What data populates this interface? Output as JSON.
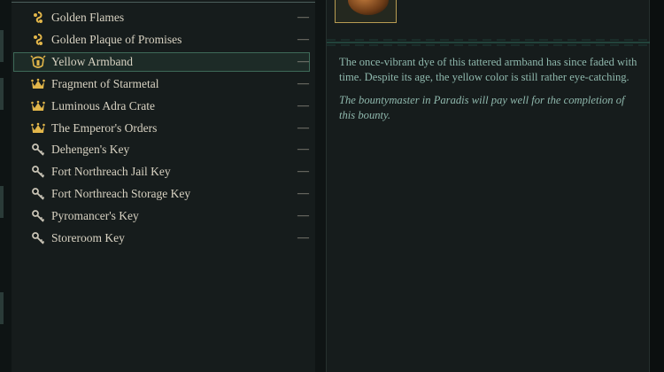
{
  "items": [
    {
      "label": "Golden Flames",
      "icon": "swirl-icon",
      "status": "—"
    },
    {
      "label": "Golden Plaque of Promises",
      "icon": "swirl-icon",
      "status": "—"
    },
    {
      "label": "Yellow Armband",
      "icon": "helmet-icon",
      "status": "—",
      "selected": true
    },
    {
      "label": "Fragment of Starmetal",
      "icon": "crown-icon",
      "status": "—"
    },
    {
      "label": "Luminous Adra Crate",
      "icon": "crown-icon",
      "status": "—"
    },
    {
      "label": "The Emperor's Orders",
      "icon": "crown-icon",
      "status": "—"
    },
    {
      "label": "Dehengen's Key",
      "icon": "key-icon",
      "status": "—"
    },
    {
      "label": "Fort Northreach Jail Key",
      "icon": "key-icon",
      "status": "—"
    },
    {
      "label": "Fort Northreach Storage Key",
      "icon": "key-icon",
      "status": "—"
    },
    {
      "label": "Pyromancer's Key",
      "icon": "key-icon",
      "status": "—"
    },
    {
      "label": "Storeroom Key",
      "icon": "key-icon",
      "status": "—"
    }
  ],
  "detail": {
    "description": "The once-vibrant dye of this tattered armband has since faded with time. Despite its age, the yellow color is still rather eye-catching.",
    "flavor": "The bountymaster in Paradis will pay well for the completion of this bounty."
  },
  "colors": {
    "selected_outline": "#3e6a58",
    "gold_icon": "#e2b64a",
    "key_icon": "#c9c4b6",
    "description_text": "#8fb8ad",
    "list_text": "#d8d2c2"
  }
}
